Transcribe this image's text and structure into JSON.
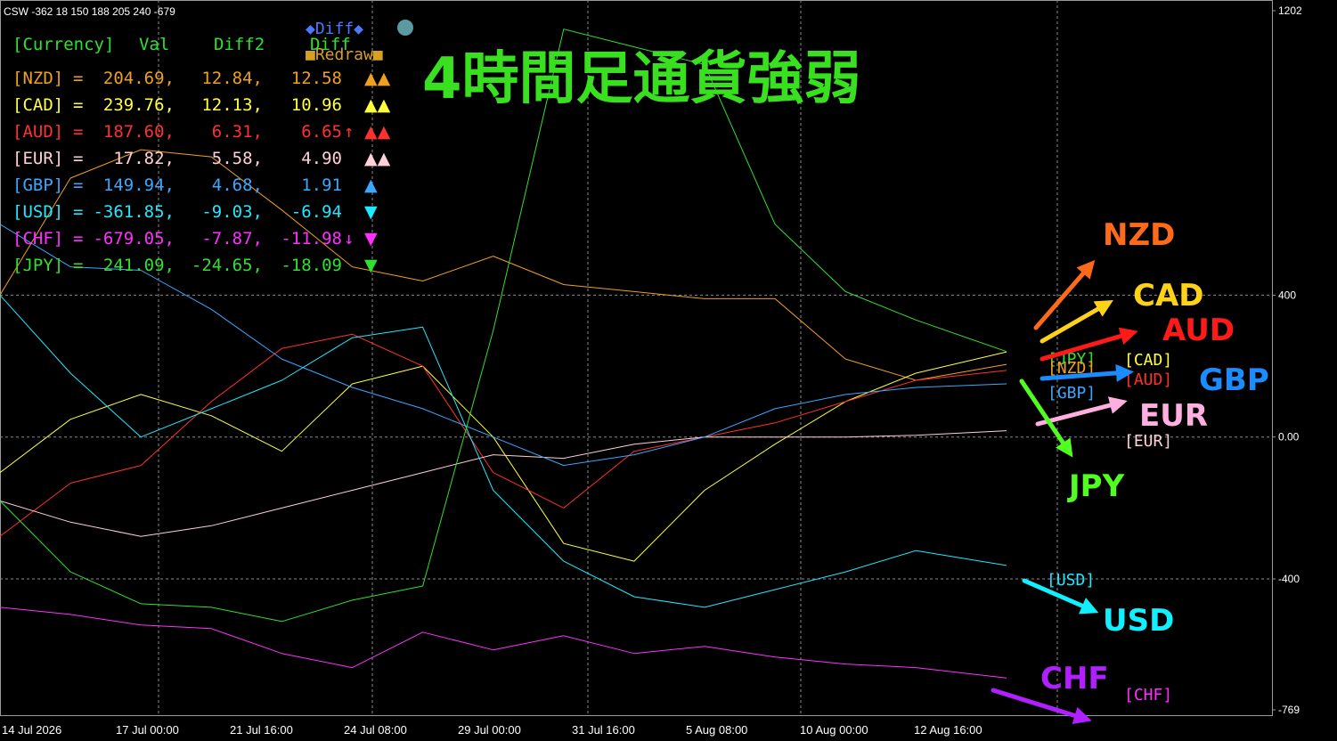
{
  "window": {
    "header": "CSW -362 18 150 188 205 240 -679"
  },
  "overlay_title": "4時間足通貨強弱",
  "panel": {
    "header_currency": "[Currency]",
    "header_val": "Val",
    "header_diff2": "Diff2",
    "header_diff": "Diff",
    "diff_button": "◆Diff◆",
    "redraw_button": "■Redraw■",
    "rows": [
      {
        "label": "[NZD]",
        "eq": "=",
        "val": "204.69,",
        "diff2": "12.84,",
        "diff": "12.58",
        "arrow": "",
        "marks": "▲▲",
        "color": "#f0a020"
      },
      {
        "label": "[CAD]",
        "eq": "=",
        "val": "239.76,",
        "diff2": "12.13,",
        "diff": "10.96",
        "arrow": "",
        "marks": "▲▲",
        "color": "#ffff40"
      },
      {
        "label": "[AUD]",
        "eq": "=",
        "val": "187.60,",
        "diff2": "6.31,",
        "diff": "6.65",
        "arrow": "↑",
        "marks": "▲▲",
        "color": "#ff3030"
      },
      {
        "label": "[EUR]",
        "eq": "=",
        "val": "17.82,",
        "diff2": "5.58,",
        "diff": "4.90",
        "arrow": "",
        "marks": "▲▲",
        "color": "#ffd0d8"
      },
      {
        "label": "[GBP]",
        "eq": "=",
        "val": "149.94,",
        "diff2": "4.68,",
        "diff": "1.91",
        "arrow": "",
        "marks": "▲",
        "color": "#3aa8ff"
      },
      {
        "label": "[USD]",
        "eq": "=",
        "val": "-361.85,",
        "diff2": "-9.03,",
        "diff": "-6.94",
        "arrow": "",
        "marks": "▼",
        "color": "#20e8ff"
      },
      {
        "label": "[CHF]",
        "eq": "=",
        "val": "-679.05,",
        "diff2": "-7.87,",
        "diff": "-11.98",
        "arrow": "↓",
        "marks": "▼",
        "color": "#ff30ff"
      },
      {
        "label": "[JPY]",
        "eq": "=",
        "val": "241.09,",
        "diff2": "-24.65,",
        "diff": "-18.09",
        "arrow": "",
        "marks": "▼",
        "color": "#30e030"
      }
    ]
  },
  "end_labels": [
    {
      "text": "[JPY]",
      "color": "#30e030"
    },
    {
      "text": "[NZD]",
      "color": "#f0a020"
    },
    {
      "text": "[CAD]",
      "color": "#ffff40"
    },
    {
      "text": "[AUD]",
      "color": "#ff3030"
    },
    {
      "text": "[GBP]",
      "color": "#3aa8ff"
    },
    {
      "text": "[EUR]",
      "color": "#ffd0d8"
    },
    {
      "text": "[USD]",
      "color": "#20e8ff"
    },
    {
      "text": "[CHF]",
      "color": "#ff30ff"
    }
  ],
  "annotations": [
    {
      "text": "NZD",
      "color": "#ff6a1a",
      "direction": "up"
    },
    {
      "text": "CAD",
      "color": "#ffd21a",
      "direction": "up"
    },
    {
      "text": "AUD",
      "color": "#ff1a1a",
      "direction": "up"
    },
    {
      "text": "GBP",
      "color": "#1a8cff",
      "direction": "right"
    },
    {
      "text": "EUR",
      "color": "#ffb0e0",
      "direction": "up"
    },
    {
      "text": "JPY",
      "color": "#50ff20",
      "direction": "down"
    },
    {
      "text": "USD",
      "color": "#10f0ff",
      "direction": "down"
    },
    {
      "text": "CHF",
      "color": "#b020ff",
      "direction": "down"
    }
  ],
  "chart_data": {
    "type": "line",
    "y_axis_labels": [
      "1202",
      "400",
      "0.00",
      "-400",
      "-769"
    ],
    "ylim": [
      -769,
      1202
    ],
    "grid": true,
    "x_tick_labels": [
      "14 Jul 2026",
      "17 Jul 00:00",
      "21 Jul 16:00",
      "24 Jul 08:00",
      "29 Jul 00:00",
      "31 Jul 16:00",
      "5 Aug 08:00",
      "10 Aug 00:00",
      "12 Aug 16:00"
    ],
    "x_index": [
      0,
      0.07,
      0.14,
      0.21,
      0.28,
      0.35,
      0.42,
      0.49,
      0.56,
      0.63,
      0.7,
      0.77,
      0.84,
      0.91,
      1.0
    ],
    "series": [
      {
        "name": "NZD",
        "color": "#f0a020",
        "values": [
          400,
          730,
          810,
          790,
          640,
          480,
          440,
          510,
          430,
          410,
          390,
          390,
          220,
          160,
          205
        ]
      },
      {
        "name": "CAD",
        "color": "#ffff40",
        "values": [
          -100,
          50,
          120,
          60,
          -40,
          150,
          200,
          0,
          -300,
          -350,
          -150,
          -20,
          100,
          180,
          240
        ]
      },
      {
        "name": "AUD",
        "color": "#ff3030",
        "values": [
          -280,
          -130,
          -80,
          100,
          250,
          290,
          200,
          -100,
          -200,
          -40,
          0,
          40,
          100,
          160,
          188
        ]
      },
      {
        "name": "EUR",
        "color": "#ffd0d8",
        "values": [
          -180,
          -240,
          -280,
          -250,
          -200,
          -150,
          -100,
          -50,
          -60,
          -20,
          0,
          0,
          0,
          5,
          18
        ]
      },
      {
        "name": "GBP",
        "color": "#3aa8ff",
        "values": [
          600,
          480,
          470,
          360,
          220,
          140,
          80,
          0,
          -80,
          -50,
          0,
          80,
          120,
          140,
          150
        ]
      },
      {
        "name": "USD",
        "color": "#20e8ff",
        "values": [
          400,
          180,
          0,
          80,
          160,
          280,
          310,
          -150,
          -350,
          -450,
          -480,
          -430,
          -380,
          -320,
          -362
        ]
      },
      {
        "name": "CHF",
        "color": "#ff30ff",
        "values": [
          -480,
          -500,
          -530,
          -540,
          -610,
          -650,
          -550,
          -600,
          -560,
          -610,
          -590,
          -620,
          -640,
          -650,
          -679
        ]
      },
      {
        "name": "JPY",
        "color": "#30e030",
        "values": [
          -180,
          -380,
          -470,
          -480,
          -520,
          -460,
          -420,
          300,
          1150,
          1100,
          1050,
          600,
          410,
          330,
          241
        ]
      }
    ]
  }
}
